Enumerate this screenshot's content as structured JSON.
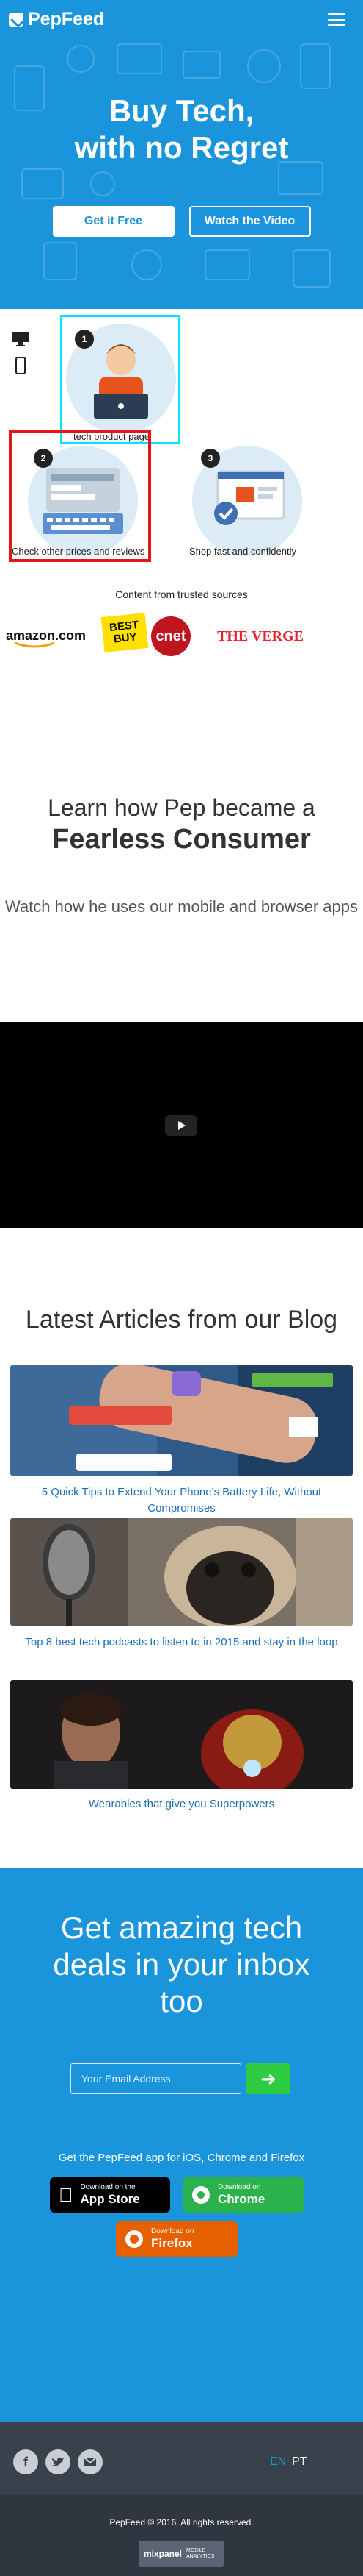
{
  "brand": {
    "name": "PepFeed",
    "accent": "#1a95dc"
  },
  "hero": {
    "title_line1": "Buy Tech,",
    "title_line2": "with no Regret",
    "btn_primary": "Get it Free",
    "btn_secondary": "Watch the Video"
  },
  "steps": [
    {
      "num": "1",
      "label": "tech product page"
    },
    {
      "num": "2",
      "label": "Check other prices and reviews"
    },
    {
      "num": "3",
      "label": "Shop fast and confidently"
    }
  ],
  "trusted": {
    "title": "Content from trusted sources",
    "brands": [
      "amazon.com",
      "BEST BUY",
      "cnet",
      "THE VERGE"
    ]
  },
  "learn": {
    "line1": "Learn how Pep became a",
    "line2": "Fearless Consumer",
    "sub": "Watch how he uses our mobile and browser apps"
  },
  "blog": {
    "title": "Latest Articles from our Blog",
    "articles": [
      {
        "caption": "5 Quick Tips to Extend Your Phone's Battery Life, Without Compromises"
      },
      {
        "caption": "Top 8 best tech podcasts to listen to in 2015 and stay in the loop"
      },
      {
        "caption": "Wearables that give you Superpowers"
      }
    ]
  },
  "newsletter": {
    "title": "Get amazing tech deals in your inbox too",
    "email_placeholder": "Your Email Address",
    "app_text": "Get the PepFeed app for iOS, Chrome and Firefox",
    "appstore_small": "Download on the",
    "appstore_big": "App Store",
    "chrome_small": "Download on",
    "chrome_big": "Chrome",
    "firefox_small": "Download on",
    "firefox_big": "Firefox"
  },
  "footer": {
    "lang_en": "EN",
    "lang_pt": "PT",
    "copyright": "PepFeed © 2016. All rights reserved.",
    "badge_name": "mixpanel",
    "badge_sub": "MOBILE ANALYTICS"
  }
}
